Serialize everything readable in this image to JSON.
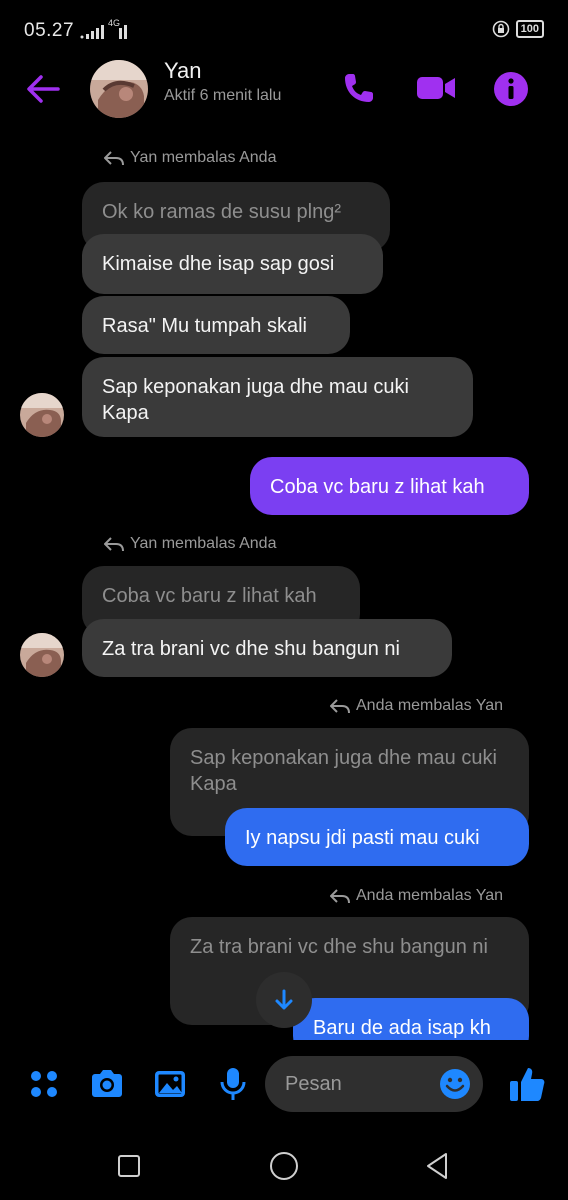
{
  "status_bar": {
    "time": "05.27",
    "network": "4G",
    "battery": "100"
  },
  "header": {
    "contact_name": "Yan",
    "contact_status": "Aktif 6 menit lalu",
    "back_icon": "arrow-left-icon",
    "call_icon": "phone-icon",
    "video_icon": "video-camera-icon",
    "info_icon": "info-icon"
  },
  "messages": {
    "reply1": {
      "label": "Yan membalas Anda",
      "quoted": "Ok ko ramas de susu plng²"
    },
    "m1": "Kimaise dhe isap sap gosi",
    "m2": "Rasa\" Mu tumpah skali",
    "m3": "Sap keponakan juga dhe mau cuki Kapa",
    "out1": "Coba vc baru z lihat kah",
    "reply2": {
      "label": "Yan membalas Anda",
      "quoted": "Coba vc baru z lihat kah"
    },
    "m4": "Za tra brani vc dhe shu bangun ni",
    "reply3": {
      "label": "Anda membalas Yan",
      "quoted": "Sap keponakan juga dhe mau cuki Kapa"
    },
    "out2": "Iy napsu jdi pasti mau cuki",
    "reply4": {
      "label": "Anda membalas Yan",
      "quoted": "Za tra brani vc dhe shu bangun ni"
    },
    "out3": "Baru de ada isap kh"
  },
  "composer": {
    "placeholder": "Pesan",
    "icons": [
      "menu-dots-icon",
      "camera-icon",
      "gallery-icon",
      "microphone-icon",
      "emoji-icon",
      "thumbs-up-icon"
    ]
  },
  "colors": {
    "accent_purple": "#a030f0",
    "outgoing_purple": "#7b3ff2",
    "outgoing_blue": "#2f6cf0",
    "composer_blue": "#1e88ff",
    "incoming_bubble": "#3a3a3a",
    "quoted_bubble": "#262626"
  },
  "nav": {
    "icons": [
      "recent-apps-icon",
      "home-icon",
      "back-icon"
    ]
  }
}
